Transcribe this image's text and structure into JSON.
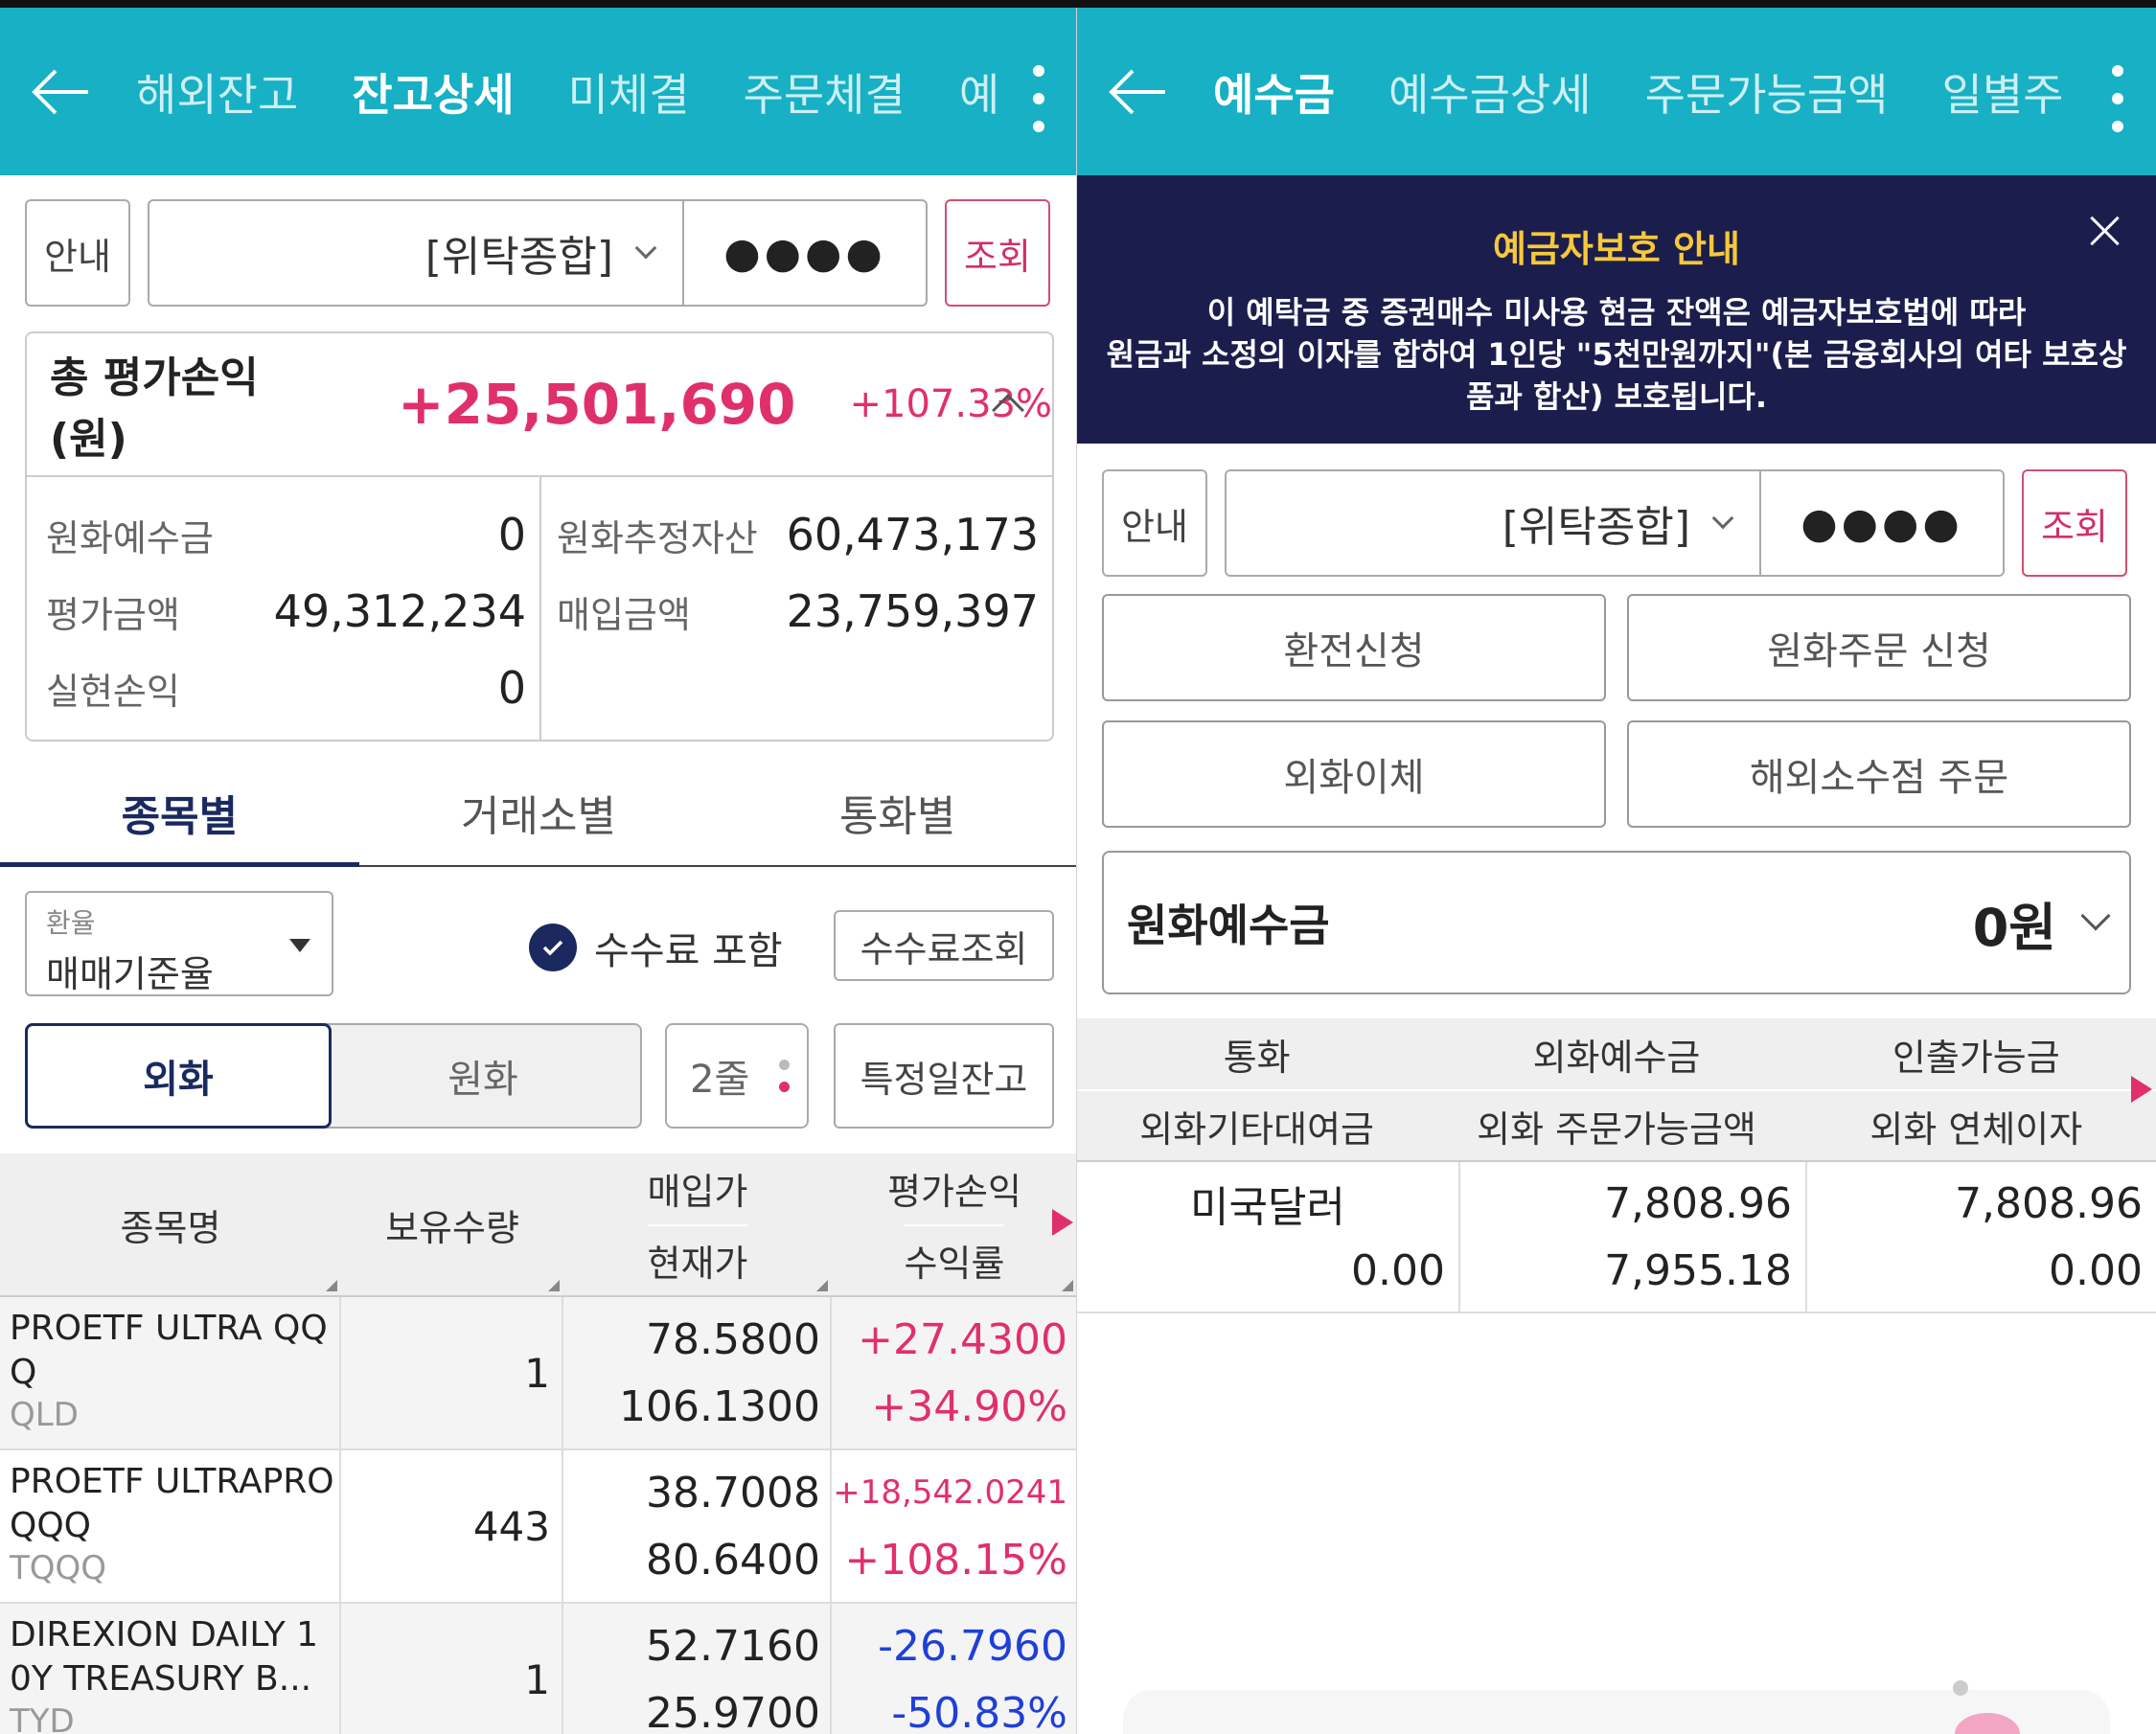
{
  "left": {
    "header": {
      "tabs": [
        "해외잔고",
        "잔고상세",
        "미체결",
        "주문체결",
        "예"
      ],
      "active_tab": 1
    },
    "account": {
      "guide_label": "안내",
      "account_name": "[위탁종합]",
      "password_mask": "●●●●",
      "query_label": "조회"
    },
    "summary": {
      "title": "총 평가손익(원)",
      "value": "+25,501,690",
      "percent": "+107.33%",
      "rows_left": [
        {
          "label": "원화예수금",
          "value": "0"
        },
        {
          "label": "평가금액",
          "value": "49,312,234"
        },
        {
          "label": "실현손익",
          "value": "0"
        }
      ],
      "rows_right": [
        {
          "label": "원화추정자산",
          "value": "60,473,173"
        },
        {
          "label": "매입금액",
          "value": "23,759,397"
        }
      ]
    },
    "subtabs": [
      "종목별",
      "거래소별",
      "통화별"
    ],
    "filters": {
      "rate_label": "환율",
      "rate_value": "매매기준율",
      "fee_include": "수수료 포함",
      "fee_query": "수수료조회",
      "currency_foreign": "외화",
      "currency_krw": "원화",
      "lines": "2줄",
      "specific_date": "특정일잔고"
    },
    "table": {
      "headers": {
        "name": "종목명",
        "qty": "보유수량",
        "buy_price": "매입가",
        "cur_price": "현재가",
        "pnl": "평가손익",
        "return": "수익률"
      },
      "rows": [
        {
          "name": "PROETF ULTRA QQQ",
          "ticker": "QLD",
          "qty": "1",
          "buy_price": "78.5800",
          "cur_price": "106.1300",
          "pnl": "+27.4300",
          "return": "+34.90%",
          "sign": "pos"
        },
        {
          "name": "PROETF ULTRAPRO QQQ",
          "ticker": "TQQQ",
          "qty": "443",
          "buy_price": "38.7008",
          "cur_price": "80.6400",
          "pnl": "+18,542.0241",
          "return": "+108.15%",
          "sign": "pos"
        },
        {
          "name": "DIREXION DAILY 10Y TREASURY B...",
          "ticker": "TYD",
          "qty": "1",
          "buy_price": "52.7160",
          "cur_price": "25.9700",
          "pnl": "-26.7960",
          "return": "-50.83%",
          "sign": "neg"
        }
      ]
    }
  },
  "right": {
    "header": {
      "tabs": [
        "예수금",
        "예수금상세",
        "주문가능금액",
        "일별주"
      ],
      "active_tab": 0
    },
    "notice": {
      "title": "예금자보호 안내",
      "body_line1": "이 예탁금 중 증권매수 미사용 현금 잔액은 예금자보호법에 따라",
      "body_line2": "원금과 소정의 이자를 합하여 1인당 \"5천만원까지\"(본 금융회사의 여타 보호상",
      "body_line3": "품과 합산) 보호됩니다."
    },
    "account": {
      "guide_label": "안내",
      "account_name": "[위탁종합]",
      "password_mask": "●●●●",
      "query_label": "조회"
    },
    "actions": {
      "exchange": "환전신청",
      "krw_order": "원화주문 신청",
      "fx_transfer": "외화이체",
      "fractional_order": "해외소수점 주문"
    },
    "deposit": {
      "label": "원화예수금",
      "value": "0원"
    },
    "table": {
      "headers_row1": [
        "통화",
        "외화예수금",
        "인출가능금"
      ],
      "headers_row2": [
        "외화기타대여금",
        "외화 주문가능금액",
        "외화 연체이자"
      ],
      "rows": [
        {
          "currency": "미국달러",
          "other_loan": "0.00",
          "deposit": "7,808.96",
          "orderable": "7,955.18",
          "withdrawable": "7,808.96",
          "overdue": "0.00"
        }
      ]
    }
  },
  "colors": {
    "header_bg": "#17b0c4",
    "accent_navy": "#1a2a60",
    "positive": "#e0306a",
    "negative": "#1f3fd8",
    "notice_bg": "#1b1e4d",
    "notice_title": "#f7c83a"
  }
}
